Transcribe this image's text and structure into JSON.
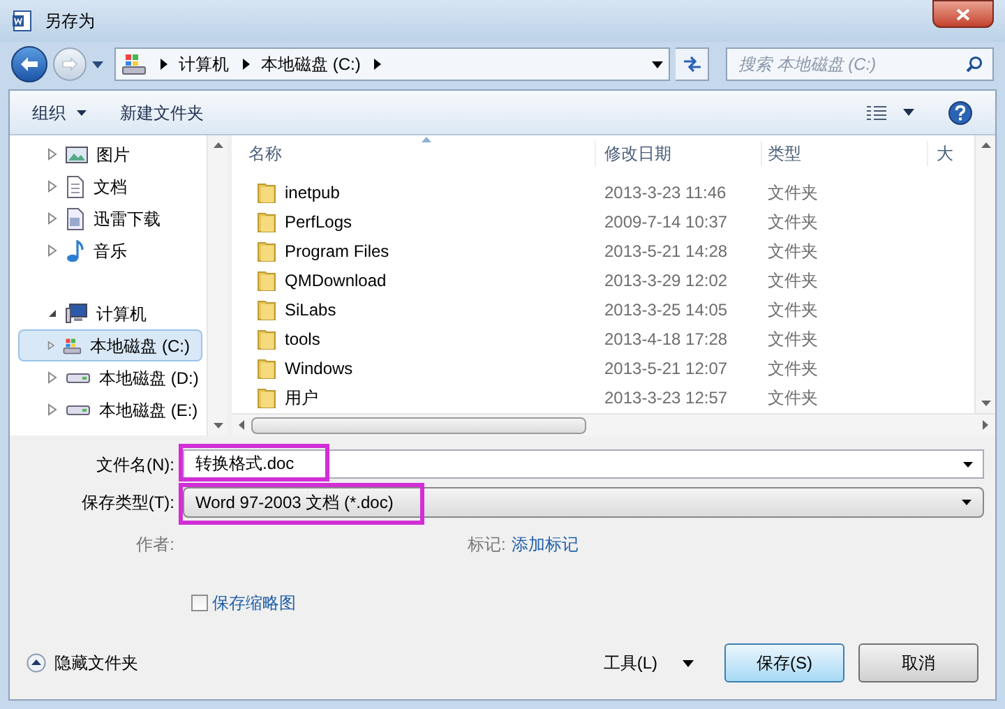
{
  "window": {
    "title": "另存为"
  },
  "address_bar": {
    "crumbs": [
      "计算机",
      "本地磁盘 (C:)"
    ]
  },
  "search": {
    "placeholder": "搜索 本地磁盘 (C:)"
  },
  "toolbar": {
    "organize": "组织",
    "new_folder": "新建文件夹"
  },
  "sidebar": {
    "items": [
      {
        "label": "图片",
        "kind": "pictures",
        "expanded": false,
        "selected": false
      },
      {
        "label": "文档",
        "kind": "documents",
        "expanded": false,
        "selected": false
      },
      {
        "label": "迅雷下载",
        "kind": "downloads",
        "expanded": false,
        "selected": false
      },
      {
        "label": "音乐",
        "kind": "music",
        "expanded": false,
        "selected": false
      },
      {
        "label": "计算机",
        "kind": "computer",
        "expanded": true,
        "selected": false,
        "children": [
          {
            "label": "本地磁盘 (C:)",
            "kind": "system-drive",
            "expanded": false,
            "selected": true
          },
          {
            "label": "本地磁盘 (D:)",
            "kind": "drive",
            "expanded": false,
            "selected": false
          },
          {
            "label": "本地磁盘 (E:)",
            "kind": "drive",
            "expanded": false,
            "selected": false
          }
        ]
      }
    ]
  },
  "table": {
    "columns": [
      "名称",
      "修改日期",
      "类型",
      "大"
    ],
    "rows": [
      {
        "name": "inetpub",
        "date": "2013-3-23 11:46",
        "type": "文件夹"
      },
      {
        "name": "PerfLogs",
        "date": "2009-7-14 10:37",
        "type": "文件夹"
      },
      {
        "name": "Program Files",
        "date": "2013-5-21 14:28",
        "type": "文件夹"
      },
      {
        "name": "QMDownload",
        "date": "2013-3-29 12:02",
        "type": "文件夹"
      },
      {
        "name": "SiLabs",
        "date": "2013-3-25 14:05",
        "type": "文件夹"
      },
      {
        "name": "tools",
        "date": "2013-4-18 17:28",
        "type": "文件夹"
      },
      {
        "name": "Windows",
        "date": "2013-5-21 12:07",
        "type": "文件夹"
      },
      {
        "name": "用户",
        "date": "2013-3-23 12:57",
        "type": "文件夹"
      }
    ]
  },
  "form": {
    "filename_label": "文件名(N):",
    "filename": "转换格式.doc",
    "type_label": "保存类型(T):",
    "type": "Word 97-2003 文档 (*.doc)",
    "author_label": "作者:",
    "tags_label": "标记:",
    "tags_link": "添加标记",
    "thumbnail": {
      "label": "保存缩略图",
      "checked": false
    }
  },
  "footer": {
    "hide_folders": "隐藏文件夹",
    "tools": "工具(L)",
    "save": "保存(S)",
    "cancel": "取消"
  }
}
